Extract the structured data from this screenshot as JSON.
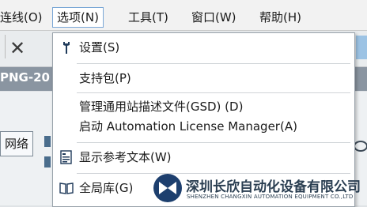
{
  "menubar": {
    "items": [
      {
        "label": "连线(O)"
      },
      {
        "label": "选项(N)"
      },
      {
        "label": "工具(T)"
      },
      {
        "label": "窗口(W)"
      },
      {
        "label": "帮助(H)"
      }
    ]
  },
  "document": {
    "title_fragment": "PNG-20"
  },
  "workarea": {
    "network_tab": "网络"
  },
  "dropdown": {
    "items": [
      {
        "label": "设置(S)",
        "icon": "wrench-icon"
      },
      {
        "label": "支持包(P)"
      },
      {
        "label": "管理通用站描述文件(GSD) (D)"
      },
      {
        "label": "启动 Automation License Manager(A)"
      },
      {
        "label": "显示参考文本(W)",
        "icon": "reference-text-icon"
      },
      {
        "label": "全局库(G)",
        "icon": "book-icon"
      }
    ]
  },
  "watermark": {
    "company_cn": "深圳长欣自动化设备有限公司",
    "company_en": "SHENZHEN CHANGXIN AUTOMATION EQUIPMENT CO.,LTD"
  },
  "colors": {
    "menu_active_border": "#7aa7d6",
    "doc_bar": "#8a95a1",
    "watermark": "#2b3f52"
  }
}
